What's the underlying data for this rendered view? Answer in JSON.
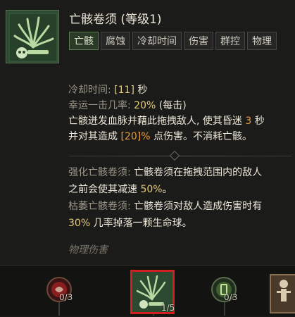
{
  "skill": {
    "title": "亡骸卷须 (等级1)",
    "tags": [
      "亡骸",
      "腐蚀",
      "冷却时间",
      "伤害",
      "群控",
      "物理"
    ]
  },
  "stats": {
    "cooldown_label": "冷却时间:",
    "cooldown_value": "[11]",
    "cooldown_unit": "秒",
    "lucky_label": "幸运一击几率:",
    "lucky_value": "20%",
    "lucky_suffix": "(每击)",
    "desc_l1a": "亡骸迸发血脉并藉此拖拽敌人, 使其昏迷",
    "desc_l1b": "3",
    "desc_l1c": "秒",
    "desc_l2a": "并对其造成",
    "desc_l2b": "[20]%",
    "desc_l2c": "点伤害。不消耗亡骸。"
  },
  "mods": {
    "m1_label": "强化亡骸卷须:",
    "m1_a": "亡骸卷须",
    "m1_b": "在拖拽范围内的敌人",
    "m1_c": "之前会使其减速",
    "m1_d": "50%",
    "m1_e": "。",
    "m2_label": "枯萎亡骸卷须:",
    "m2_a": "亡骸卷须",
    "m2_b": "对敌人造成伤害时有",
    "m2_c": "30%",
    "m2_d": "几率掉落一颗生命球。"
  },
  "footer": "物理伤害",
  "skill_tree": [
    {
      "count": "0/3",
      "icon": "blood-orb-icon"
    },
    {
      "count": "1/5",
      "icon": "tendrils-icon",
      "selected": true
    },
    {
      "count": "0/3",
      "icon": "green-rune-icon"
    },
    {
      "count": "",
      "icon": "skeleton-icon"
    }
  ],
  "colors": {
    "gold": "#e4c97e",
    "orange": "#e89a3c",
    "selected_border": "#d02020"
  }
}
